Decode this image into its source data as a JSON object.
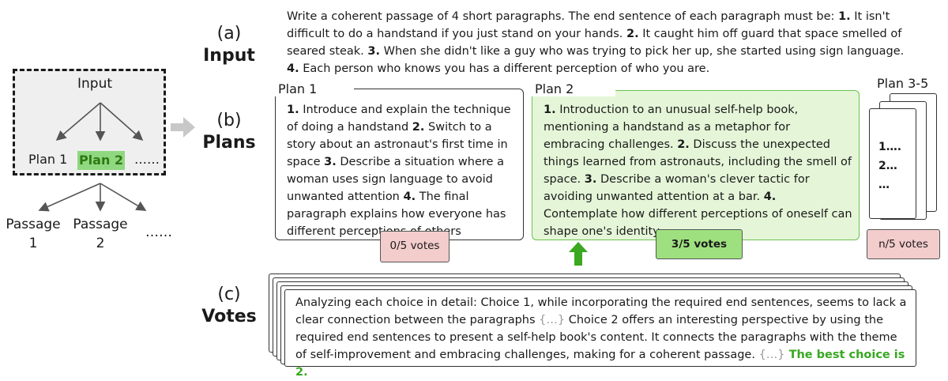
{
  "tree": {
    "input": "Input",
    "plan1": "Plan 1",
    "plan2": "Plan 2",
    "dots": "……",
    "passage1_a": "Passage",
    "passage1_b": "1",
    "passage2_a": "Passage",
    "passage2_b": "2",
    "passage_dots": "……"
  },
  "sections": {
    "a_letter": "(a)",
    "a_name": "Input",
    "b_letter": "(b)",
    "b_name": "Plans",
    "c_letter": "(c)",
    "c_name": "Votes"
  },
  "input_text": {
    "p1": "Write a coherent passage of 4 short paragraphs. The end sentence of each paragraph must be: ",
    "n1": "1.",
    "s1": " It isn't difficult to do a handstand if you just stand on your hands. ",
    "n2": "2.",
    "s2": " It caught him off guard that space smelled of seared steak. ",
    "n3": "3.",
    "s3": " When she didn't like a guy who was trying to pick her up, she started using sign language. ",
    "n4": "4.",
    "s4": " Each person who knows you has a different perception of who you are."
  },
  "plan1": {
    "title": "Plan 1",
    "n1": "1.",
    "s1": " Introduce and explain the technique of doing a handstand ",
    "n2": "2.",
    "s2": " Switch to a story about an astronaut's first time in space ",
    "n3": "3.",
    "s3": " Describe a situation where a woman uses sign language to avoid unwanted attention ",
    "n4": "4.",
    "s4": " The final paragraph explains how everyone has different perceptions of others",
    "votes": "0/5 votes"
  },
  "plan2": {
    "title": "Plan 2",
    "n1": "1.",
    "s1": " Introduction to an unusual self-help book, mentioning a handstand as a metaphor for embracing challenges. ",
    "n2": "2.",
    "s2": " Discuss the unexpected things learned from astronauts, including the smell of space. ",
    "n3": "3.",
    "s3": " Describe a woman's clever tactic for avoiding unwanted attention at a bar. ",
    "n4": "4.",
    "s4": " Contemplate how different perceptions of oneself can shape one's identity.",
    "votes": "3/5 votes"
  },
  "plan35": {
    "title": "Plan 3-5",
    "l1": "1….",
    "l2": "2…",
    "l3": "…",
    "votes": "n/5 votes"
  },
  "vote_text": {
    "t1": "Analyzing each choice in detail:  Choice 1, while incorporating the required end sentences, seems to lack a clear connection between the paragraphs ",
    "e1": "{…}",
    "t2": " Choice 2 offers an interesting perspective by using the required end sentences to present a self-help book's content. It connects the paragraphs with the theme of self-improvement and embracing challenges, making for a coherent passage.  ",
    "e2": "{…}",
    "best": " The best choice is 2."
  },
  "colors": {
    "plan2_fill": "#e5f6d8",
    "plan2_border": "#6bc24e",
    "highlight": "#8fd880",
    "vote_red": "#f3cccc",
    "vote_green": "#9ee07f",
    "arrow_green": "#3aa820",
    "best_text": "#37a821"
  }
}
